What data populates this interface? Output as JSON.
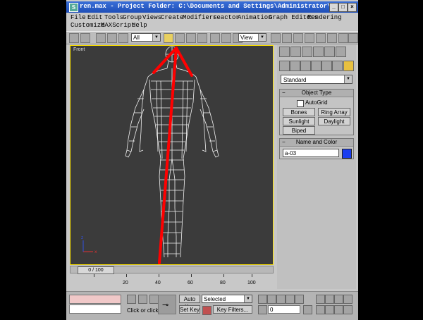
{
  "window": {
    "title": "ren.max   - Project Folder: C:\\Documents and Settings\\Administrator\\...",
    "app_icon": "S",
    "min": "_",
    "max": "□",
    "close": "×"
  },
  "menu": {
    "file": "File",
    "edit": "Edit",
    "tools": "Tools",
    "group": "Group",
    "views": "Views",
    "create": "Create",
    "modifiers": "Modifiers",
    "reactor": "reactor",
    "animation": "Animation",
    "graph_editors": "Graph Editors",
    "rendering": "Rendering",
    "customize": "Customize",
    "maxscript": "MAXScript",
    "help": "Help"
  },
  "toolbar": {
    "selection_filter": "All",
    "coord_system": "View"
  },
  "viewport": {
    "label": "Front"
  },
  "panel": {
    "category": "Standard",
    "object_type": {
      "title": "Object Type",
      "autogrid": "AutoGrid",
      "bones": "Bones",
      "ring_array": "Ring Array",
      "sunlight": "Sunlight",
      "daylight": "Daylight",
      "biped": "Biped"
    },
    "name_color": {
      "title": "Name and Color",
      "name_value": "a-03",
      "color": "#1a3df0"
    }
  },
  "timeline": {
    "frame_display": "0 / 100",
    "ruler_labels": [
      "20",
      "40",
      "60",
      "80",
      "100"
    ]
  },
  "status": {
    "prompt": "Click or click",
    "auto_key": "Auto Key",
    "set_key": "Set Key",
    "key_mode": "Selected",
    "key_filters": "Key Filters...",
    "frame_field": "0"
  },
  "colors": {
    "viewport_border": "#ffe400",
    "annotation": "#ff0000"
  }
}
